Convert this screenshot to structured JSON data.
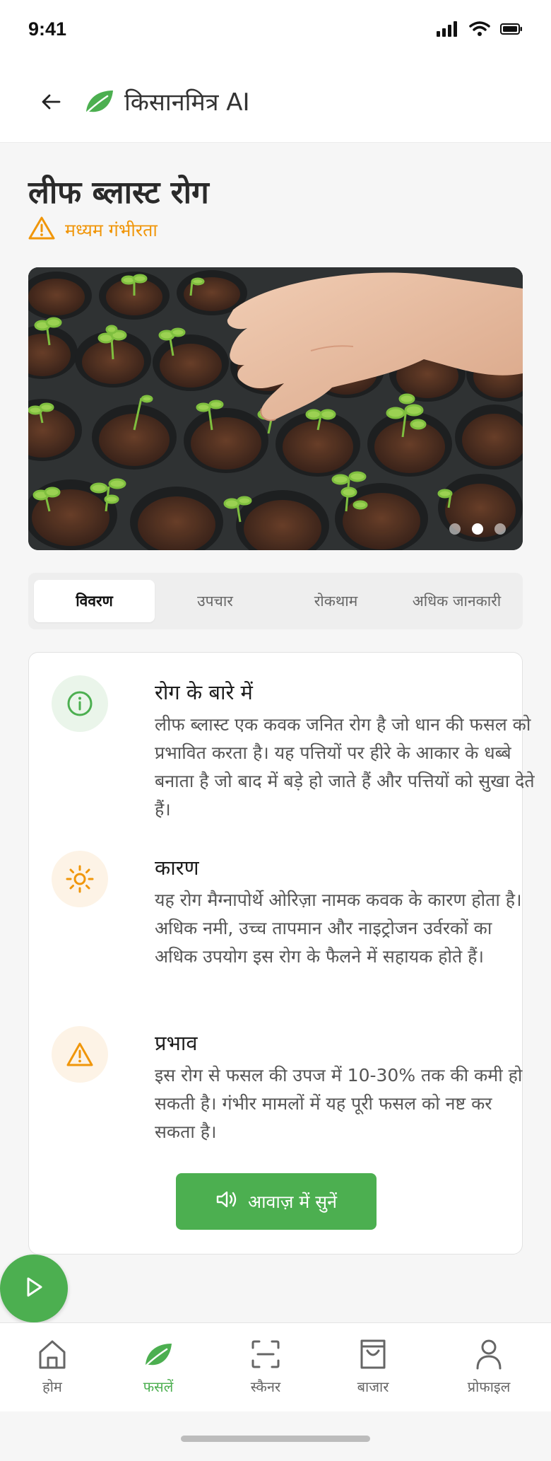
{
  "status_bar": {
    "time": "9:41"
  },
  "header": {
    "brand": "किसानमित्र AI"
  },
  "disease": {
    "title": "लीफ ब्लास्ट रोग",
    "severity": "मध्यम गंभीरता"
  },
  "carousel": {
    "active_index": 1,
    "count": 3
  },
  "tabs": [
    {
      "label": "विवरण",
      "active": true
    },
    {
      "label": "उपचार",
      "active": false
    },
    {
      "label": "रोकथाम",
      "active": false
    },
    {
      "label": "अधिक जानकारी",
      "active": false
    }
  ],
  "sections": [
    {
      "icon": "info-icon",
      "title": "रोग के बारे में",
      "text": "लीफ ब्लास्ट एक कवक जनित रोग है जो धान की फसल को प्रभावित करता है। यह पत्तियों पर हीरे के आकार के धब्बे बनाता है जो बाद में बड़े हो जाते हैं और पत्तियों को सुखा देते हैं।"
    },
    {
      "icon": "sun-icon",
      "title": "कारण",
      "text": "यह रोग मैग्नापोर्थे ओरिज़ा नामक कवक के कारण होता है। अधिक नमी, उच्च तापमान और नाइट्रोजन उर्वरकों का अधिक उपयोग इस रोग के फैलने में सहायक होते हैं।"
    },
    {
      "icon": "warning-icon",
      "title": "प्रभाव",
      "text": "इस रोग से फसल की उपज में 10-30% तक की कमी हो सकती है। गंभीर मामलों में यह पूरी फसल को नष्ट कर सकता है।"
    }
  ],
  "listen_button": {
    "label": "आवाज़ में सुनें"
  },
  "bottom_nav": [
    {
      "label": "होम",
      "icon": "home-icon",
      "active": false
    },
    {
      "label": "फसलें",
      "icon": "leaf-icon",
      "active": true
    },
    {
      "label": "स्कैनर",
      "icon": "scan-icon",
      "active": false
    },
    {
      "label": "बाजार",
      "icon": "shopping-bag-icon",
      "active": false
    },
    {
      "label": "प्रोफाइल",
      "icon": "user-icon",
      "active": false
    }
  ],
  "colors": {
    "accent": "#4caf50",
    "warning": "#f0960a"
  }
}
